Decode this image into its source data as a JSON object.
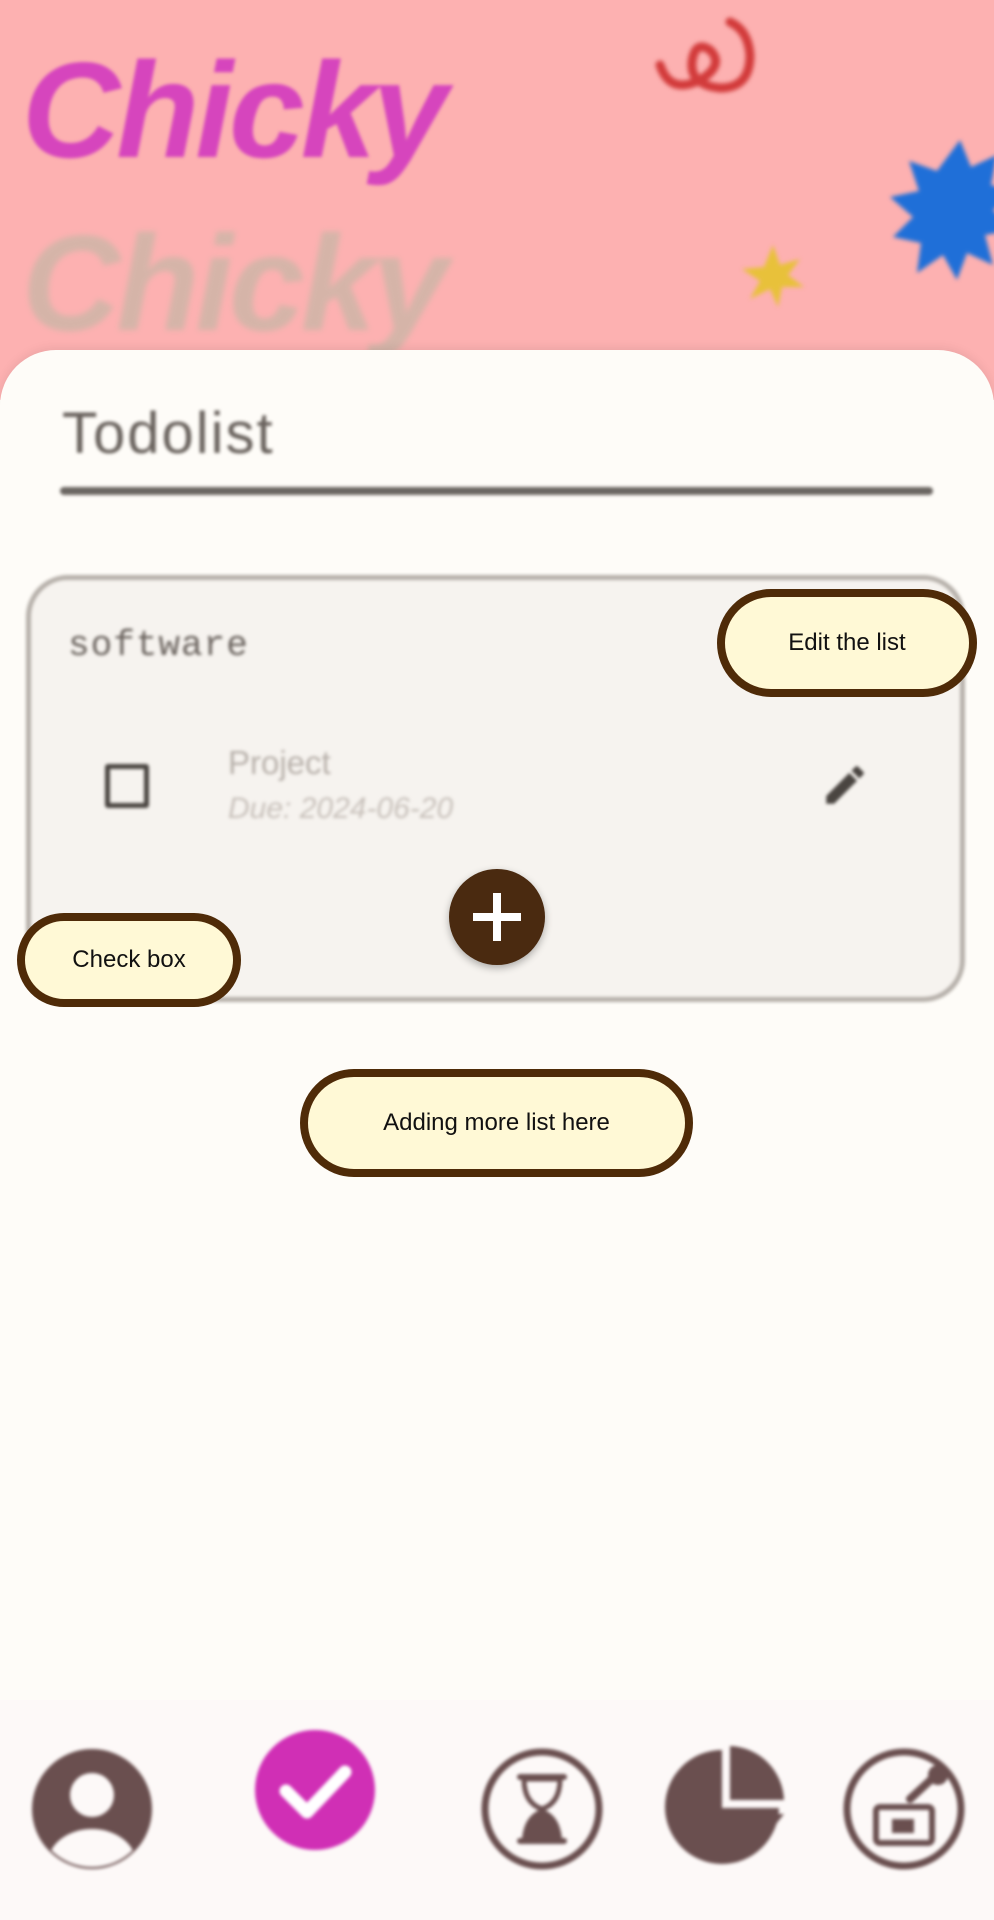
{
  "header": {
    "logo_text": "Chicky",
    "ghost_text": "Chicky"
  },
  "main": {
    "title": "Todolist",
    "list": {
      "name": "software",
      "items": [
        {
          "name": "Project",
          "due": "Due: 2024-06-20",
          "checked": false
        }
      ]
    }
  },
  "tooltips": {
    "edit": "Edit the list",
    "checkbox": "Check box",
    "add": "Adding more list here"
  },
  "nav": {
    "items": [
      {
        "icon": "profile-icon"
      },
      {
        "icon": "check-icon",
        "active": true
      },
      {
        "icon": "hourglass-icon"
      },
      {
        "icon": "pie-chart-icon"
      },
      {
        "icon": "shop-icon"
      }
    ],
    "active_color": "#d02fb5",
    "icon_color": "#6a4f4f"
  },
  "colors": {
    "header_bg": "#fdb1b1",
    "accent_dark": "#4a2a10",
    "tooltip_bg": "#fff9d6"
  }
}
